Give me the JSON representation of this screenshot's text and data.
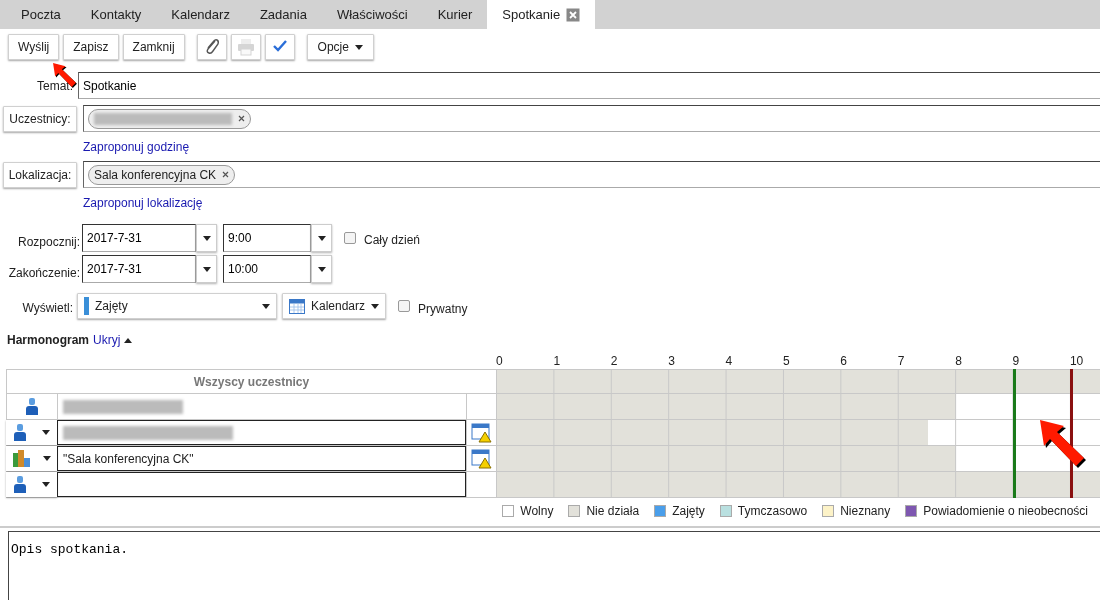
{
  "tabs": [
    {
      "label": "Poczta",
      "selected": false
    },
    {
      "label": "Kontakty",
      "selected": false
    },
    {
      "label": "Kalendarz",
      "selected": false
    },
    {
      "label": "Zadania",
      "selected": false
    },
    {
      "label": "Właściwości",
      "selected": false
    },
    {
      "label": "Kurier",
      "selected": false
    },
    {
      "label": "Spotkanie",
      "selected": true,
      "closable": true
    }
  ],
  "toolbar": {
    "buttons": [
      {
        "label": "Wyślij"
      },
      {
        "label": "Zapisz"
      },
      {
        "label": "Zamknij"
      }
    ],
    "icon_buttons": [
      {
        "kind": "attach",
        "disabled": false
      },
      {
        "kind": "print",
        "disabled": true
      },
      {
        "kind": "spellcheck",
        "disabled": false
      }
    ],
    "menu": {
      "label": "Opcje"
    }
  },
  "subject": {
    "label": "Temat:",
    "value": "Spotkanie"
  },
  "attendees": {
    "button": "Uczestnicy:",
    "chips": [
      {
        "kind": "blurred"
      }
    ],
    "link": "Zaproponuj godzinę"
  },
  "location": {
    "button": "Lokalizacja:",
    "chips": [
      {
        "kind": "text",
        "label": "Sala konferencyjna CK"
      }
    ],
    "link": "Zaproponuj lokalizację"
  },
  "start": {
    "label": "Rozpocznij:",
    "date": "2017-7-31",
    "time": "9:00",
    "all_day": {
      "label": "Cały dzień",
      "checked": false
    }
  },
  "end": {
    "label": "Zakończenie:",
    "date": "2017-7-31",
    "time": "10:00"
  },
  "show_as": {
    "label": "Wyświetl:",
    "value": "Zajęty",
    "calendar": "Kalendarz",
    "private": {
      "label": "Prywatny",
      "checked": false
    }
  },
  "schedule": {
    "title": "Harmonogram",
    "toggle": "Ukryj",
    "expanded": true,
    "header": "Wszyscy uczestnicy",
    "hours": [
      {
        "label": "0"
      },
      {
        "label": "1"
      },
      {
        "label": "2"
      },
      {
        "label": "3"
      },
      {
        "label": "4"
      },
      {
        "label": "5"
      },
      {
        "label": "6"
      },
      {
        "label": "7"
      },
      {
        "label": "8"
      },
      {
        "label": "9",
        "meeting_start": true
      },
      {
        "label": "10",
        "meeting_end": true
      }
    ],
    "summary": {
      "level": 1
    },
    "rows": [
      {
        "kind": "person",
        "blurred": true,
        "has_menu": false,
        "warning": false,
        "level": 0.762
      },
      {
        "kind": "person",
        "blurred": true,
        "has_menu": true,
        "warning": true,
        "level": 0.714
      },
      {
        "kind": "room",
        "name": "\"Sala konferencyjna CK\"",
        "has_menu": true,
        "warning": true,
        "level": 0.762
      },
      {
        "kind": "person",
        "has_menu": true,
        "warning": false,
        "level": 1
      }
    ],
    "legend": [
      {
        "label": "Wolny",
        "color": "#ffffff"
      },
      {
        "label": "Nie działa",
        "color": "#e2e1da"
      },
      {
        "label": "Zajęty",
        "color": "#4a9eea"
      },
      {
        "label": "Tymczasowo",
        "color": "#b9e0e0"
      },
      {
        "label": "Nieznany",
        "color": "#fdf3c8"
      },
      {
        "label": "Powiadomienie o nieobecności",
        "color": "#7e57b0"
      }
    ]
  },
  "description": {
    "value": "Opis spotkania."
  }
}
